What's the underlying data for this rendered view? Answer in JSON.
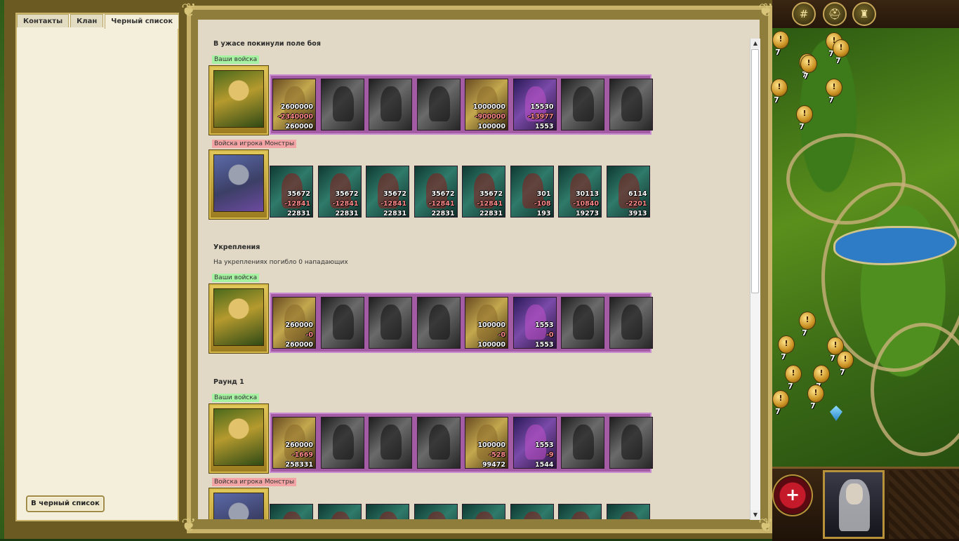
{
  "tabs": [
    "Контакты",
    "Клан",
    "Черный список"
  ],
  "blacklist_button": "В черный список",
  "sections": {
    "fled": "В ужасе покинули поле боя",
    "fortifications": "Укрепления",
    "fortifications_note": "На укреплениях погибло 0 нападающих",
    "round1": "Раунд 1"
  },
  "labels": {
    "your_troops": "Ваши войска",
    "enemy_troops": "Войска игрока Монстры"
  },
  "fled_your": [
    {
      "a": "2600000",
      "l": "-2340000",
      "r": "260000",
      "style": "color"
    },
    {
      "a": "",
      "l": "",
      "r": "",
      "style": "gray"
    },
    {
      "a": "",
      "l": "",
      "r": "",
      "style": "gray"
    },
    {
      "a": "",
      "l": "",
      "r": "",
      "style": "gray"
    },
    {
      "a": "1000000",
      "l": "-900000",
      "r": "100000",
      "style": "color"
    },
    {
      "a": "15530",
      "l": "-13977",
      "r": "1553",
      "style": "purp"
    },
    {
      "a": "",
      "l": "",
      "r": "",
      "style": "gray"
    },
    {
      "a": "",
      "l": "",
      "r": "",
      "style": "gray"
    }
  ],
  "fled_enemy": [
    {
      "a": "35672",
      "l": "-12841",
      "r": "22831"
    },
    {
      "a": "35672",
      "l": "-12841",
      "r": "22831"
    },
    {
      "a": "35672",
      "l": "-12841",
      "r": "22831"
    },
    {
      "a": "35672",
      "l": "-12841",
      "r": "22831"
    },
    {
      "a": "35672",
      "l": "-12841",
      "r": "22831"
    },
    {
      "a": "301",
      "l": "-108",
      "r": "193"
    },
    {
      "a": "30113",
      "l": "-10840",
      "r": "19273"
    },
    {
      "a": "6114",
      "l": "-2201",
      "r": "3913"
    }
  ],
  "fort_your": [
    {
      "a": "260000",
      "l": "-0",
      "r": "260000",
      "style": "color"
    },
    {
      "a": "",
      "l": "",
      "r": "",
      "style": "gray"
    },
    {
      "a": "",
      "l": "",
      "r": "",
      "style": "gray"
    },
    {
      "a": "",
      "l": "",
      "r": "",
      "style": "gray"
    },
    {
      "a": "100000",
      "l": "-0",
      "r": "100000",
      "style": "color"
    },
    {
      "a": "1553",
      "l": "-0",
      "r": "1553",
      "style": "purp"
    },
    {
      "a": "",
      "l": "",
      "r": "",
      "style": "gray"
    },
    {
      "a": "",
      "l": "",
      "r": "",
      "style": "gray"
    }
  ],
  "round1_your": [
    {
      "a": "260000",
      "l": "-1669",
      "r": "258331",
      "style": "color"
    },
    {
      "a": "",
      "l": "",
      "r": "",
      "style": "gray"
    },
    {
      "a": "",
      "l": "",
      "r": "",
      "style": "gray"
    },
    {
      "a": "",
      "l": "",
      "r": "",
      "style": "gray"
    },
    {
      "a": "100000",
      "l": "-528",
      "r": "99472",
      "style": "color"
    },
    {
      "a": "1553",
      "l": "-9",
      "r": "1544",
      "style": "purp"
    },
    {
      "a": "",
      "l": "",
      "r": "",
      "style": "gray"
    },
    {
      "a": "",
      "l": "",
      "r": "",
      "style": "gray"
    }
  ],
  "map": {
    "markers": [
      {
        "label": "7"
      },
      {
        "label": "7"
      },
      {
        "label": "7"
      },
      {
        "label": "7"
      },
      {
        "label": "7"
      },
      {
        "label": "7"
      },
      {
        "label": "7"
      },
      {
        "label": "7"
      },
      {
        "label": "7"
      },
      {
        "label": "7"
      },
      {
        "label": "7"
      },
      {
        "label": "7"
      },
      {
        "label": "7"
      },
      {
        "label": "7"
      },
      {
        "label": "7"
      },
      {
        "label": "7"
      }
    ]
  },
  "top_buttons": [
    "settings-icon",
    "helmet-icon",
    "castle-icon"
  ],
  "colors": {
    "panel": "#f3efda",
    "content": "#e1d9c6",
    "frame": "#c9b36a",
    "your_tag": "#a7f2a2",
    "enemy_tag": "#f3a4a4"
  }
}
